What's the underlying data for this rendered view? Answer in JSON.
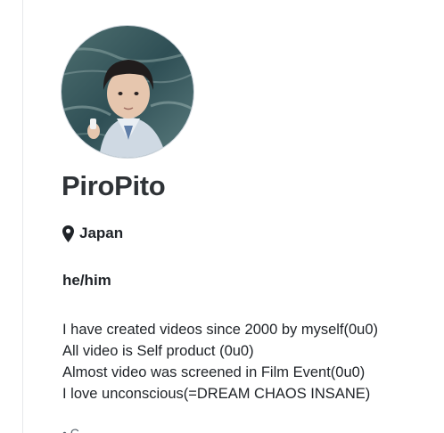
{
  "profile": {
    "display_name": "PiroPito",
    "avatar_icon": "profile-photo",
    "location": "Japan",
    "location_icon": "map-pin-icon",
    "pronouns": "he/him",
    "bio_lines": [
      "I have created videos since 2000 by myself(0u0)",
      "All video is Self product (0u0)",
      "Almost video was screened in Film Event(0u0)",
      "I love unconscious(=DREAM CHAOS INSANE)"
    ],
    "truncated_next_item": "• C"
  }
}
